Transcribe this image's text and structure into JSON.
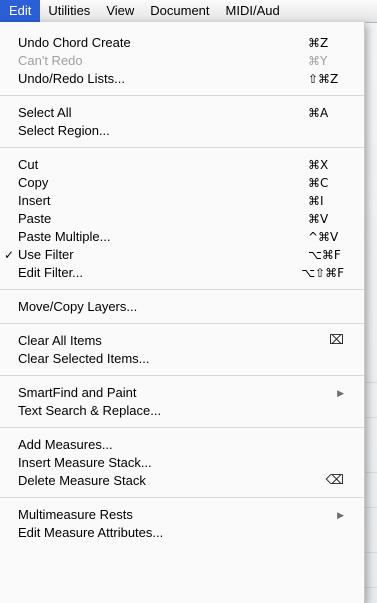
{
  "menubar": {
    "items": [
      {
        "label": "Edit"
      },
      {
        "label": "Utilities"
      },
      {
        "label": "View"
      },
      {
        "label": "Document"
      },
      {
        "label": "MIDI/Aud"
      }
    ]
  },
  "edit_menu": {
    "groups": [
      {
        "items": [
          {
            "label": "Undo Chord Create",
            "shortcut": "⌘Z"
          },
          {
            "label": "Can't Redo",
            "shortcut": "⌘Y",
            "disabled": true
          },
          {
            "label": "Undo/Redo Lists...",
            "shortcut": "⇧⌘Z"
          }
        ]
      },
      {
        "items": [
          {
            "label": "Select All",
            "shortcut": "⌘A"
          },
          {
            "label": "Select Region...",
            "shortcut": ""
          }
        ]
      },
      {
        "items": [
          {
            "label": "Cut",
            "shortcut": "⌘X"
          },
          {
            "label": "Copy",
            "shortcut": "⌘C"
          },
          {
            "label": "Insert",
            "shortcut": "⌘I"
          },
          {
            "label": "Paste",
            "shortcut": "⌘V"
          },
          {
            "label": "Paste Multiple...",
            "shortcut": "^⌘V"
          },
          {
            "label": "Use Filter",
            "shortcut": "⌥⌘F",
            "checked": true,
            "check_mark": "✓"
          },
          {
            "label": "Edit Filter...",
            "shortcut": "⌥⇧⌘F"
          }
        ]
      },
      {
        "items": [
          {
            "label": "Move/Copy Layers...",
            "shortcut": ""
          }
        ]
      },
      {
        "items": [
          {
            "label": "Clear All Items",
            "shortcut": "⌧",
            "icon": "clear-icon"
          },
          {
            "label": "Clear Selected Items...",
            "shortcut": ""
          }
        ]
      },
      {
        "items": [
          {
            "label": "SmartFind and Paint",
            "submenu": true,
            "arrow": "▶"
          },
          {
            "label": "Text Search & Replace...",
            "shortcut": ""
          }
        ]
      },
      {
        "items": [
          {
            "label": "Add Measures...",
            "shortcut": ""
          },
          {
            "label": "Insert Measure Stack...",
            "shortcut": ""
          },
          {
            "label": "Delete Measure Stack",
            "shortcut": "⌫",
            "icon": "delete-key-icon"
          }
        ]
      },
      {
        "items": [
          {
            "label": "Multimeasure Rests",
            "submenu": true,
            "arrow": "▶"
          },
          {
            "label": "Edit Measure Attributes...",
            "shortcut": ""
          }
        ]
      }
    ]
  },
  "colors": {
    "menu_highlight": "#2a5fd6",
    "disabled_text": "#a0a0a0",
    "menu_background": "#fafafa"
  }
}
